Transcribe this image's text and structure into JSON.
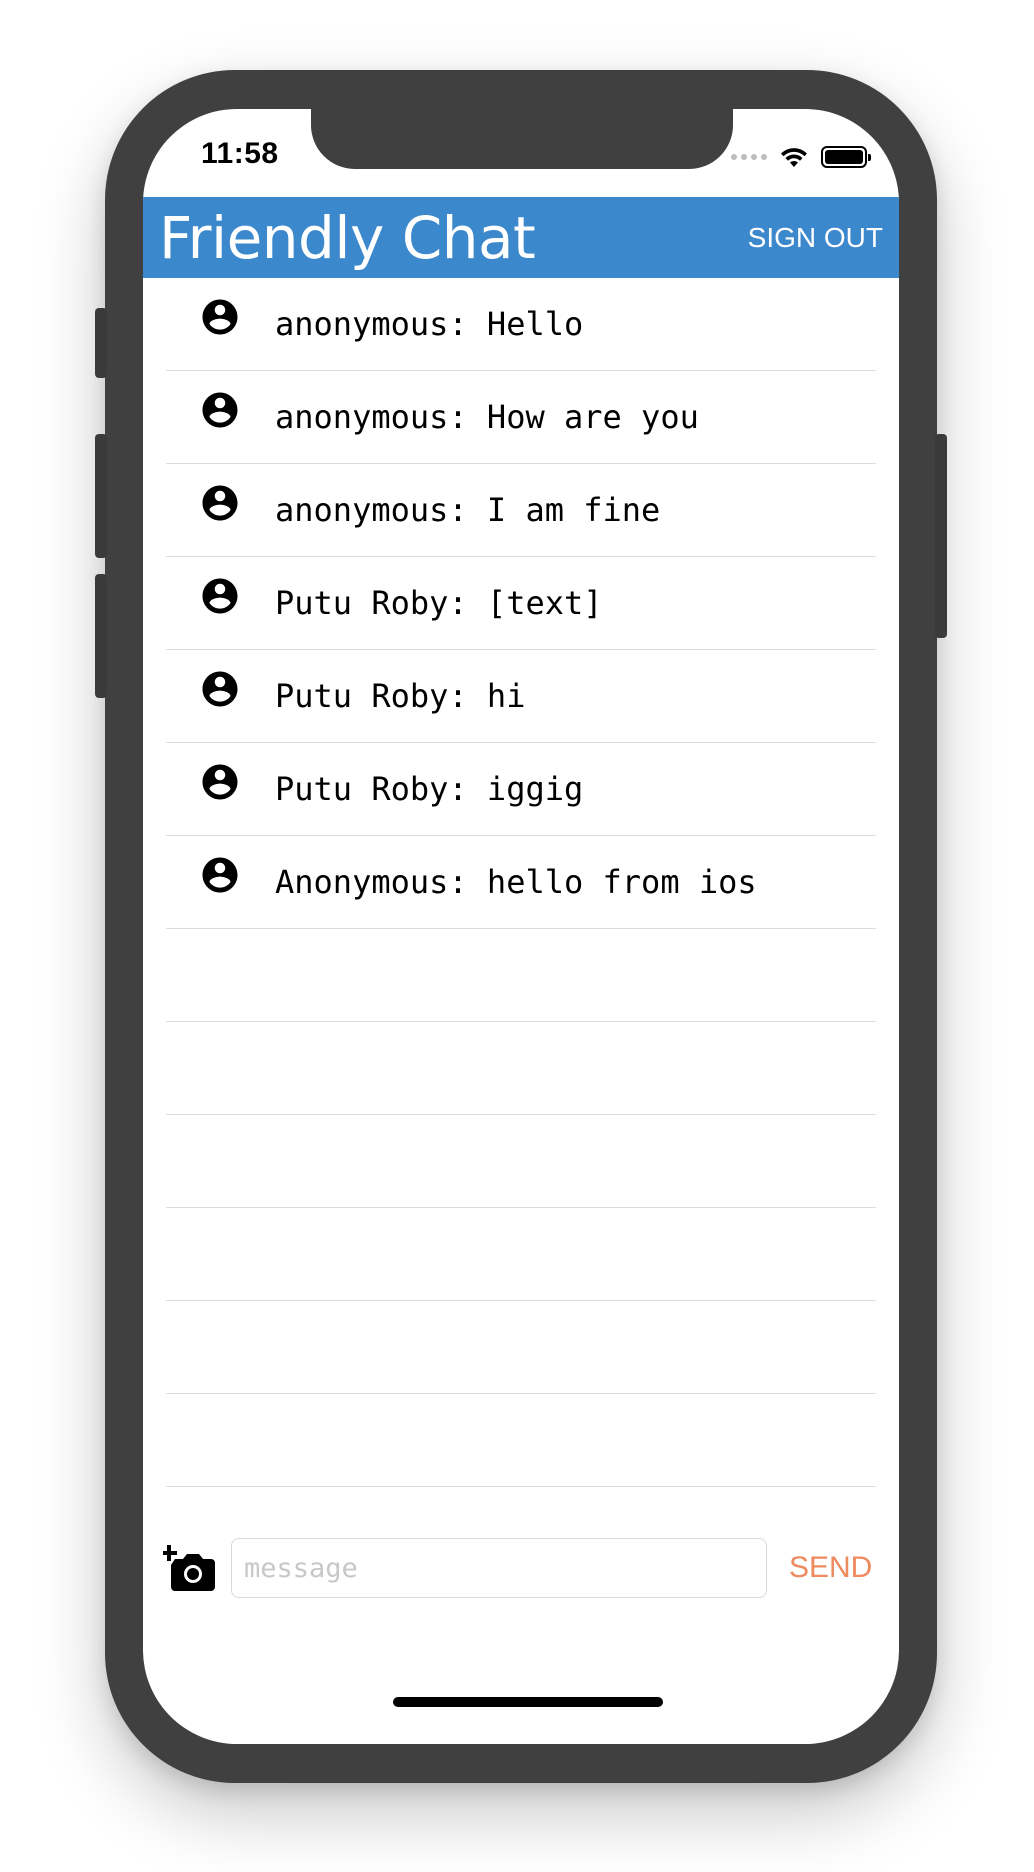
{
  "status_bar": {
    "time": "11:58"
  },
  "app_bar": {
    "title": "Friendly Chat",
    "sign_out_label": "SIGN OUT",
    "color": "#3c88cd"
  },
  "messages": [
    {
      "text": "anonymous: Hello",
      "icon": "account-circle-icon"
    },
    {
      "text": "anonymous: How are you",
      "icon": "account-circle-icon"
    },
    {
      "text": "anonymous: I am fine",
      "icon": "account-circle-icon"
    },
    {
      "text": "Putu Roby: [text]",
      "icon": "account-circle-icon"
    },
    {
      "text": "Putu Roby: hi",
      "icon": "account-circle-icon"
    },
    {
      "text": "Putu Roby: iggig",
      "icon": "account-circle-icon"
    },
    {
      "text": "Anonymous: hello from ios",
      "icon": "account-circle-icon"
    }
  ],
  "composer": {
    "placeholder": "message",
    "value": "",
    "send_label": "SEND",
    "send_color": "#ee8a5e",
    "camera_icon": "add-a-photo-icon"
  }
}
